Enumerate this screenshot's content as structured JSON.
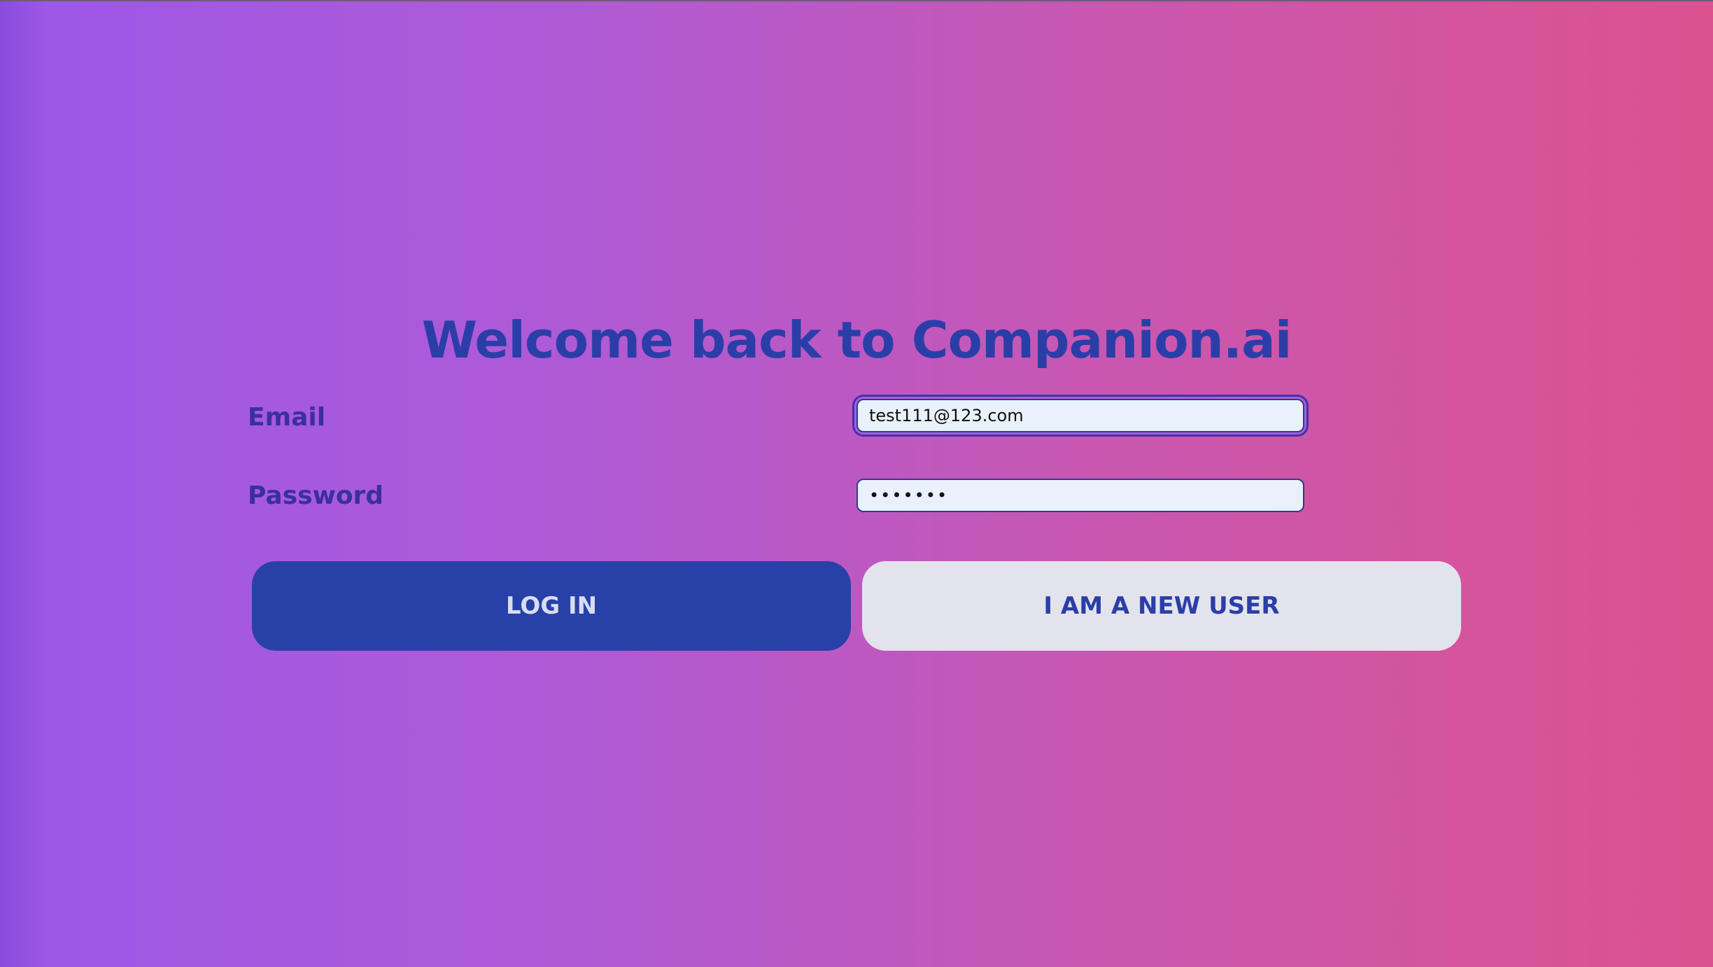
{
  "page": {
    "title": "Welcome back to Companion.ai"
  },
  "form": {
    "email_label": "Email",
    "email_value": "test111@123.com",
    "password_label": "Password",
    "password_value": "1234567"
  },
  "buttons": {
    "login_label": "LOG IN",
    "new_user_label": "I AM A NEW USER"
  },
  "colors": {
    "gradient_start": "#9c58e8",
    "gradient_end": "#dc5290",
    "primary": "#2841a8",
    "secondary_button": "#e3e3ec",
    "input_background": "#e9f1fd"
  }
}
